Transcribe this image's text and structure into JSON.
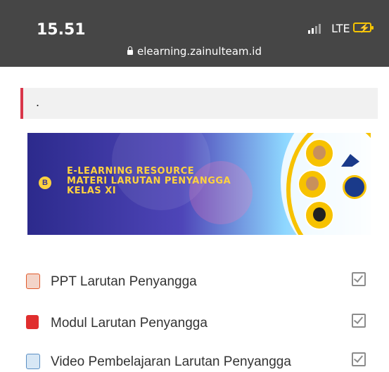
{
  "status_bar": {
    "time": "15.51",
    "network": "LTE",
    "url": "elearning.zainulteam.id"
  },
  "notice": {
    "text": "."
  },
  "banner": {
    "badge": "B",
    "line1": "E-LEARNING RESOURCE",
    "line2": "MATERI LARUTAN PENYANGGA",
    "line3": "KELAS XI"
  },
  "activities": [
    {
      "label": "PPT Larutan Penyangga",
      "icon": "powerpoint-icon",
      "completed": true
    },
    {
      "label": "Modul Larutan Penyangga",
      "icon": "pdf-icon",
      "completed": true
    },
    {
      "label": "Video Pembelajaran Larutan Penyangga",
      "icon": "video-file-icon",
      "completed": true
    }
  ],
  "colors": {
    "status_bar_bg": "#464646",
    "notice_accent": "#d9364a",
    "banner_text": "#ffd23f",
    "banner_bg": "#4e45b8"
  }
}
